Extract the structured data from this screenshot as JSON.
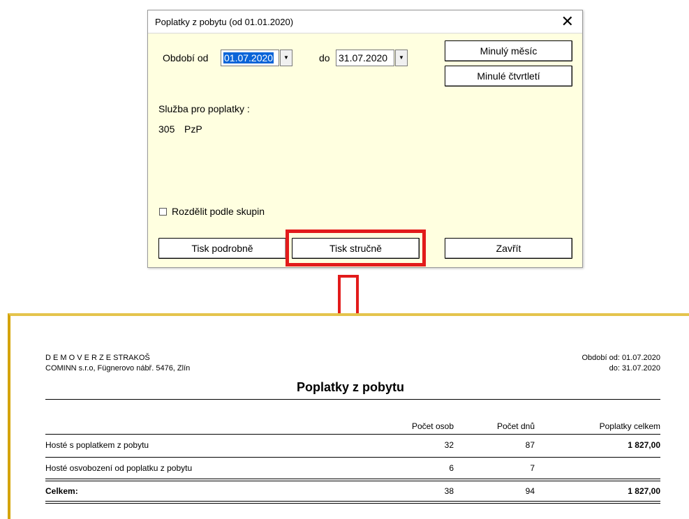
{
  "dialog": {
    "title": "Poplatky z pobytu (od 01.01.2020)",
    "close_glyph": "✕",
    "period_from_label": "Období od",
    "period_from_value": "01.07.2020",
    "period_to_label": "do",
    "period_to_value": "31.07.2020",
    "last_month_label": "Minulý měsíc",
    "last_quarter_label": "Minulé čtvrtletí",
    "service_label": "Služba pro poplatky :",
    "service_code": "305",
    "service_name": "PzP",
    "split_groups_label": "Rozdělit podle skupin",
    "split_groups_checked": false,
    "print_detailed_label": "Tisk podrobně",
    "print_brief_label": "Tisk stručně",
    "close_label": "Zavřít"
  },
  "colors": {
    "highlight": "#e21b1b",
    "dialog_bg": "#ffffe0",
    "selection": "#0a64d8"
  },
  "report": {
    "company_line1": "D E M O V E R Z E STRAKOŠ",
    "company_line2": "COMINN s.r.o, Fügnerovo nábř. 5476, Zlín",
    "period_from": "Období od: 01.07.2020",
    "period_to": "do: 31.07.2020",
    "title": "Poplatky z pobytu",
    "columns": [
      "Počet osob",
      "Počet dnů",
      "Poplatky celkem"
    ],
    "rows": [
      {
        "label": "Hosté s poplatkem z pobytu",
        "persons": "32",
        "days": "87",
        "fees": "1 827,00"
      },
      {
        "label": "Hosté osvobození od poplatku z pobytu",
        "persons": "6",
        "days": "7",
        "fees": ""
      }
    ],
    "total": {
      "label": "Celkem:",
      "persons": "38",
      "days": "94",
      "fees": "1 827,00"
    }
  }
}
